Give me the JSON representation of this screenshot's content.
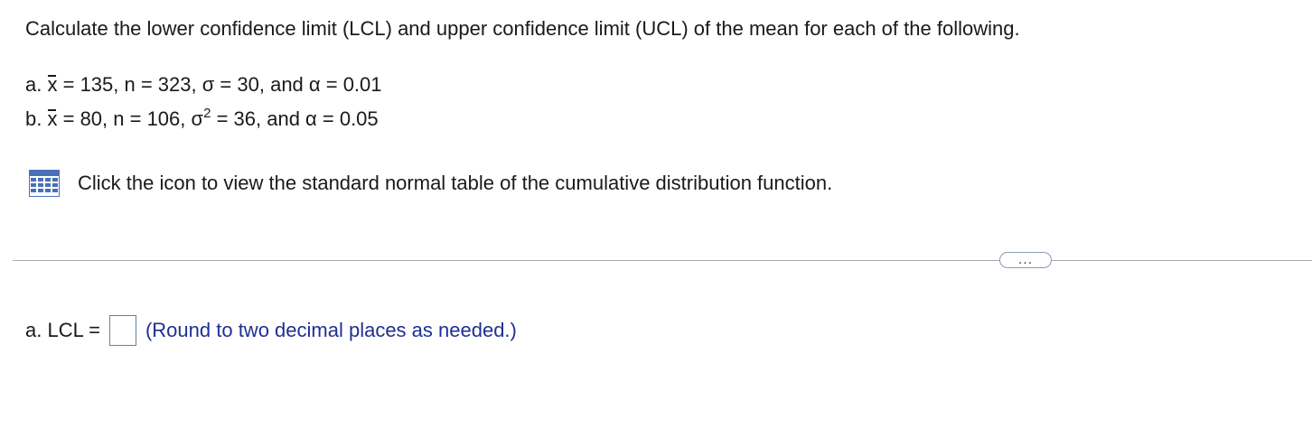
{
  "question": {
    "prompt": "Calculate the lower confidence limit (LCL) and upper confidence limit (UCL) of the mean for each of the following."
  },
  "parts": {
    "a": {
      "prefix": "a.",
      "xbar_symbol": "x",
      "rest": "= 135, n = 323, σ = 30, and α = 0.01"
    },
    "b": {
      "prefix": "b.",
      "xbar_symbol": "x",
      "middle": "= 80, n = 106, σ",
      "exponent": "2",
      "rest": "= 36, and α = 0.05"
    }
  },
  "hint": {
    "icon": "table-grid-icon",
    "text": "Click the icon to view the standard normal table of the cumulative distribution function."
  },
  "more_button": {
    "label": "..."
  },
  "answer": {
    "label": "a. LCL =",
    "value": "",
    "round_hint": "(Round to two decimal places as needed.)"
  },
  "colors": {
    "text": "#1a1a1a",
    "hint_blue": "#1f2f93",
    "icon_blue": "#4a6fb5",
    "divider": "#a9a9a9"
  }
}
